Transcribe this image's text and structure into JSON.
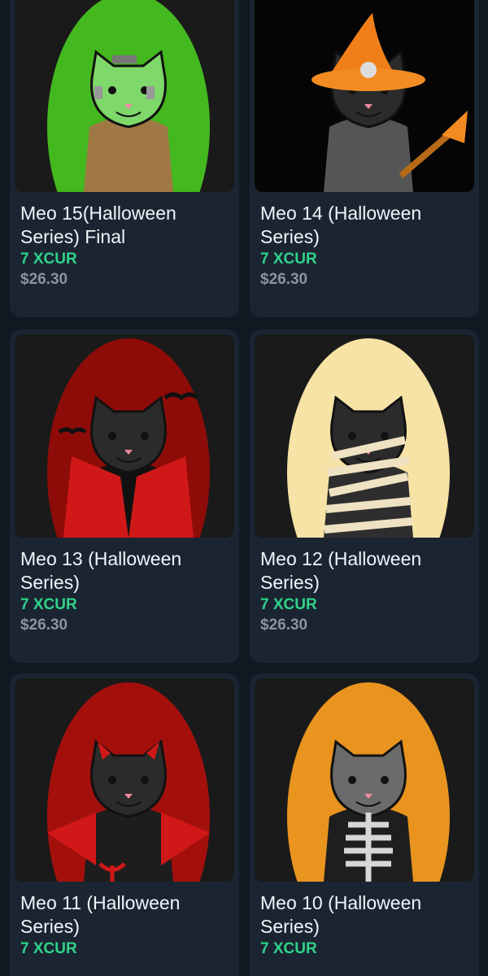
{
  "items": [
    {
      "name": "Meo 15(Halloween Series) Final",
      "price": "7 XCUR",
      "usd": "$26.30",
      "bg": "#1a1a1a",
      "glow": "#44b81f",
      "theme": "frankenstein"
    },
    {
      "name": "Meo 14 (Halloween Series)",
      "price": "7 XCUR",
      "usd": "$26.30",
      "bg": "#050505",
      "glow": "#050505",
      "theme": "witch"
    },
    {
      "name": "Meo 13 (Halloween Series)",
      "price": "7 XCUR",
      "usd": "$26.30",
      "bg": "#1a1a1a",
      "glow": "#8e0c08",
      "theme": "vampire"
    },
    {
      "name": "Meo 12 (Halloween Series)",
      "price": "7 XCUR",
      "usd": "$26.30",
      "bg": "#1a1a1a",
      "glow": "#f7e3a6",
      "theme": "mummy"
    },
    {
      "name": "Meo 11 (Halloween Series)",
      "price": "7 XCUR",
      "usd": "",
      "bg": "#1a1a1a",
      "glow": "#a3100c",
      "theme": "devil"
    },
    {
      "name": "Meo 10 (Halloween Series)",
      "price": "7 XCUR",
      "usd": "",
      "bg": "#1a1a1a",
      "glow": "#e8941f",
      "theme": "skeleton"
    }
  ],
  "colors": {
    "background": "#111822",
    "card": "#1b2532",
    "price": "#2fd38a",
    "usd": "#8a939f"
  }
}
